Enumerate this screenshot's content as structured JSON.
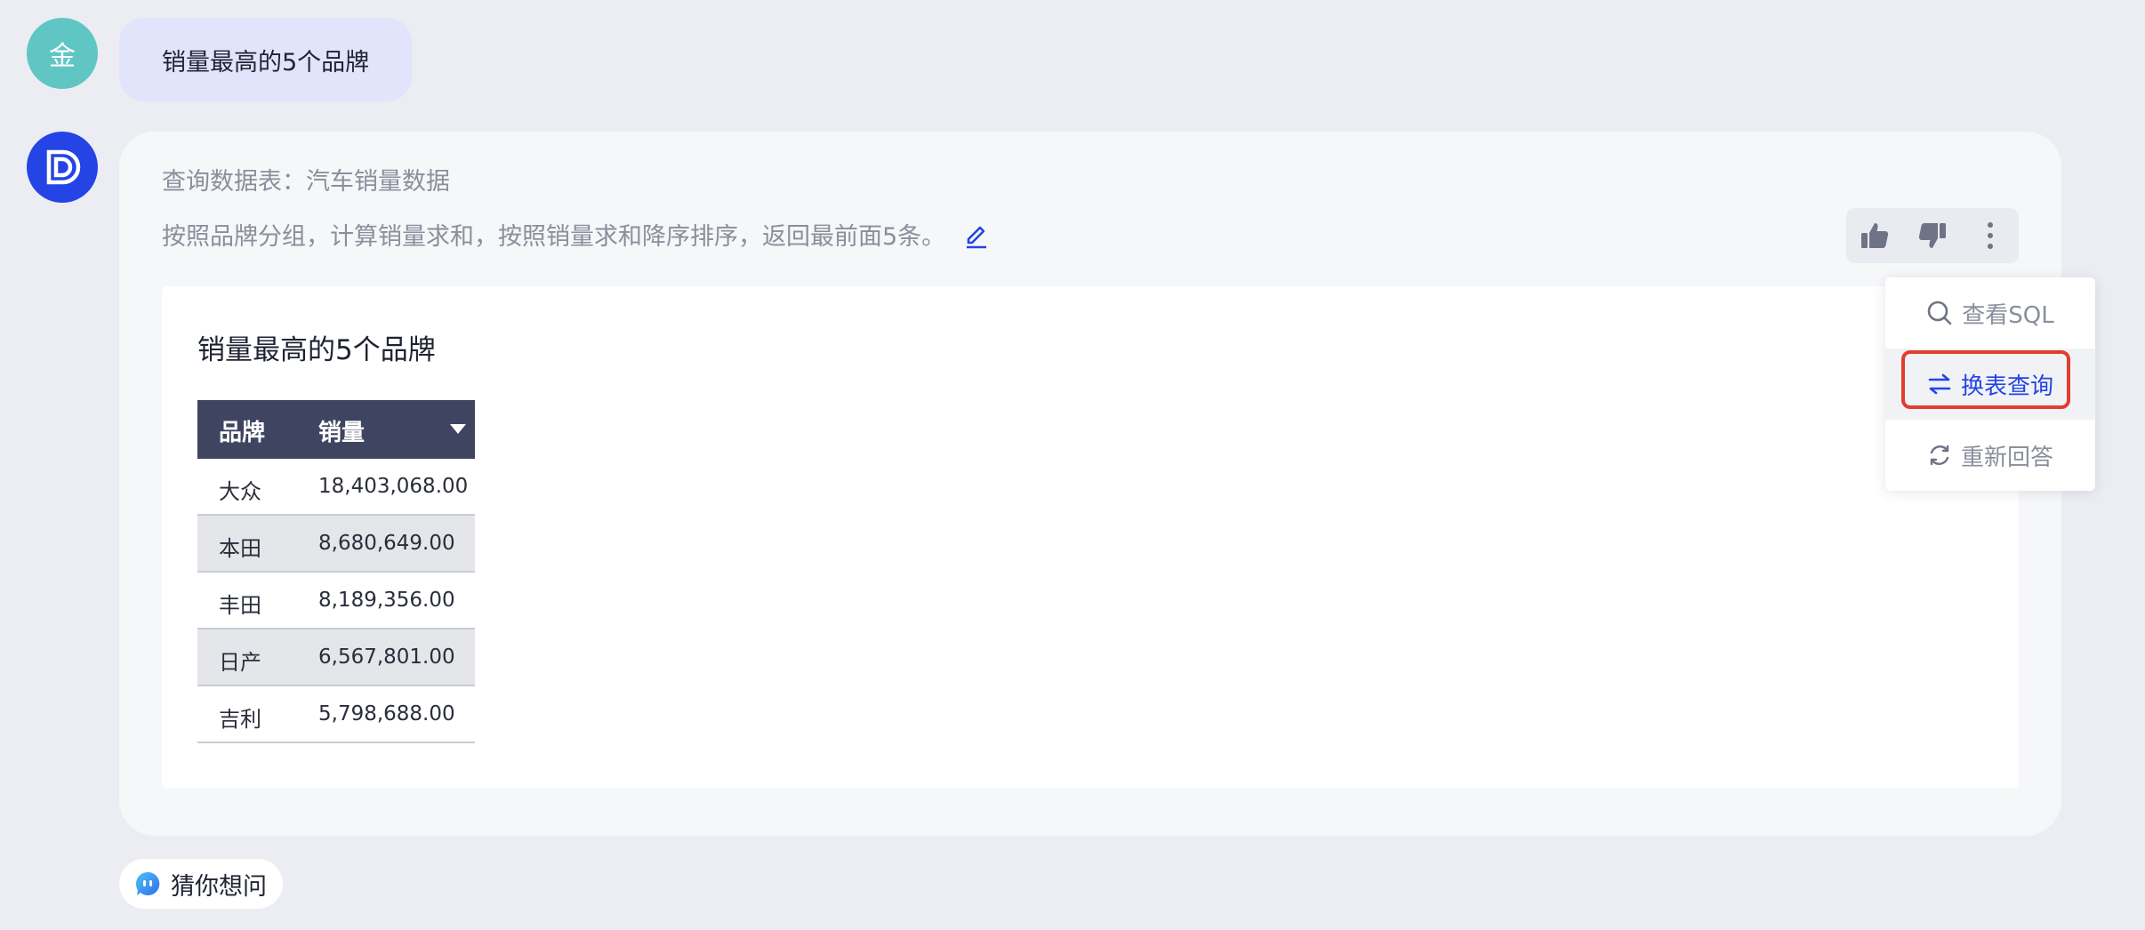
{
  "user": {
    "avatar_text": "金",
    "question": "销量最高的5个品牌"
  },
  "bot": {
    "query_table": "查询数据表：汽车销量数据",
    "query_desc": "按照品牌分组，计算销量求和，按照销量求和降序排序，返回最前面5条。"
  },
  "result": {
    "title": "销量最高的5个品牌",
    "columns": [
      "品牌",
      "销量"
    ],
    "rows": [
      [
        "大众",
        "18,403,068.00"
      ],
      [
        "本田",
        "8,680,649.00"
      ],
      [
        "丰田",
        "8,189,356.00"
      ],
      [
        "日产",
        "6,567,801.00"
      ],
      [
        "吉利",
        "5,798,688.00"
      ]
    ]
  },
  "menu": {
    "view_sql": "查看SQL",
    "switch_table": "换表查询",
    "regenerate": "重新回答"
  },
  "suggestion": {
    "label": "猜你想问"
  },
  "colors": {
    "accent": "#2544e6",
    "highlight": "#e23d2f",
    "header_bg": "#3f4560"
  }
}
